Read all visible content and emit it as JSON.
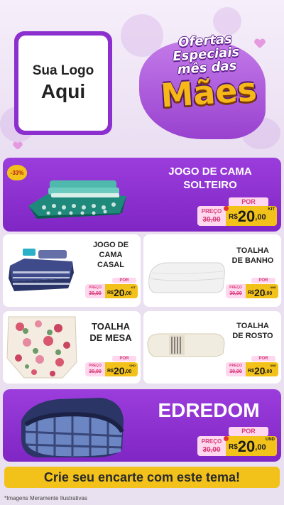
{
  "logo": {
    "line1": "Sua Logo",
    "line2": "Aqui"
  },
  "title": {
    "line1": "Ofertas",
    "line2": "Especiais",
    "line3": "mês das",
    "line4": "Mães"
  },
  "products": [
    {
      "name_line1": "JOGO DE CAMA",
      "name_line2": "SOLTEIRO",
      "discount": "-33%",
      "por": "POR",
      "preco": "PREÇO",
      "de": "DE",
      "old_price": "30,00",
      "currency": "R$",
      "price_int": "20",
      "price_dec": ",00",
      "unit": "KIT"
    },
    {
      "name_line1": "JOGO DE",
      "name_line2": "CAMA",
      "name_line3": "CASAL",
      "por": "POR",
      "preco": "PREÇO",
      "de": "DE",
      "old_price": "30,00",
      "currency": "R$",
      "price_int": "20",
      "price_dec": ",00",
      "unit": "KIT"
    },
    {
      "name_line1": "TOALHA",
      "name_line2": "DE BANHO",
      "por": "POR",
      "preco": "PREÇO",
      "de": "DE",
      "old_price": "30,00",
      "currency": "R$",
      "price_int": "20",
      "price_dec": ",00",
      "unit": "UND"
    },
    {
      "name_line1": "TOALHA",
      "name_line2": "DE MESA",
      "por": "POR",
      "preco": "PREÇO",
      "de": "DE",
      "old_price": "30,00",
      "currency": "R$",
      "price_int": "20",
      "price_dec": ",00",
      "unit": "UND"
    },
    {
      "name_line1": "TOALHA",
      "name_line2": "DE ROSTO",
      "por": "POR",
      "preco": "PREÇO",
      "de": "DE",
      "old_price": "30,00",
      "currency": "R$",
      "price_int": "20",
      "price_dec": ",00",
      "unit": "UND"
    },
    {
      "name_line1": "EDREDOM",
      "por": "POR",
      "preco": "PREÇO",
      "de": "DE",
      "old_price": "30,00",
      "currency": "R$",
      "price_int": "20",
      "price_dec": ",00",
      "unit": "UND"
    }
  ],
  "cta": "Crie seu encarte com este tema!",
  "footnote": "*Imagens Meramente Ilustrativas",
  "colors": {
    "purple": "#8c2fcf",
    "yellow": "#f2c21a",
    "pink": "#ffd8ef",
    "red": "#d63a76"
  }
}
